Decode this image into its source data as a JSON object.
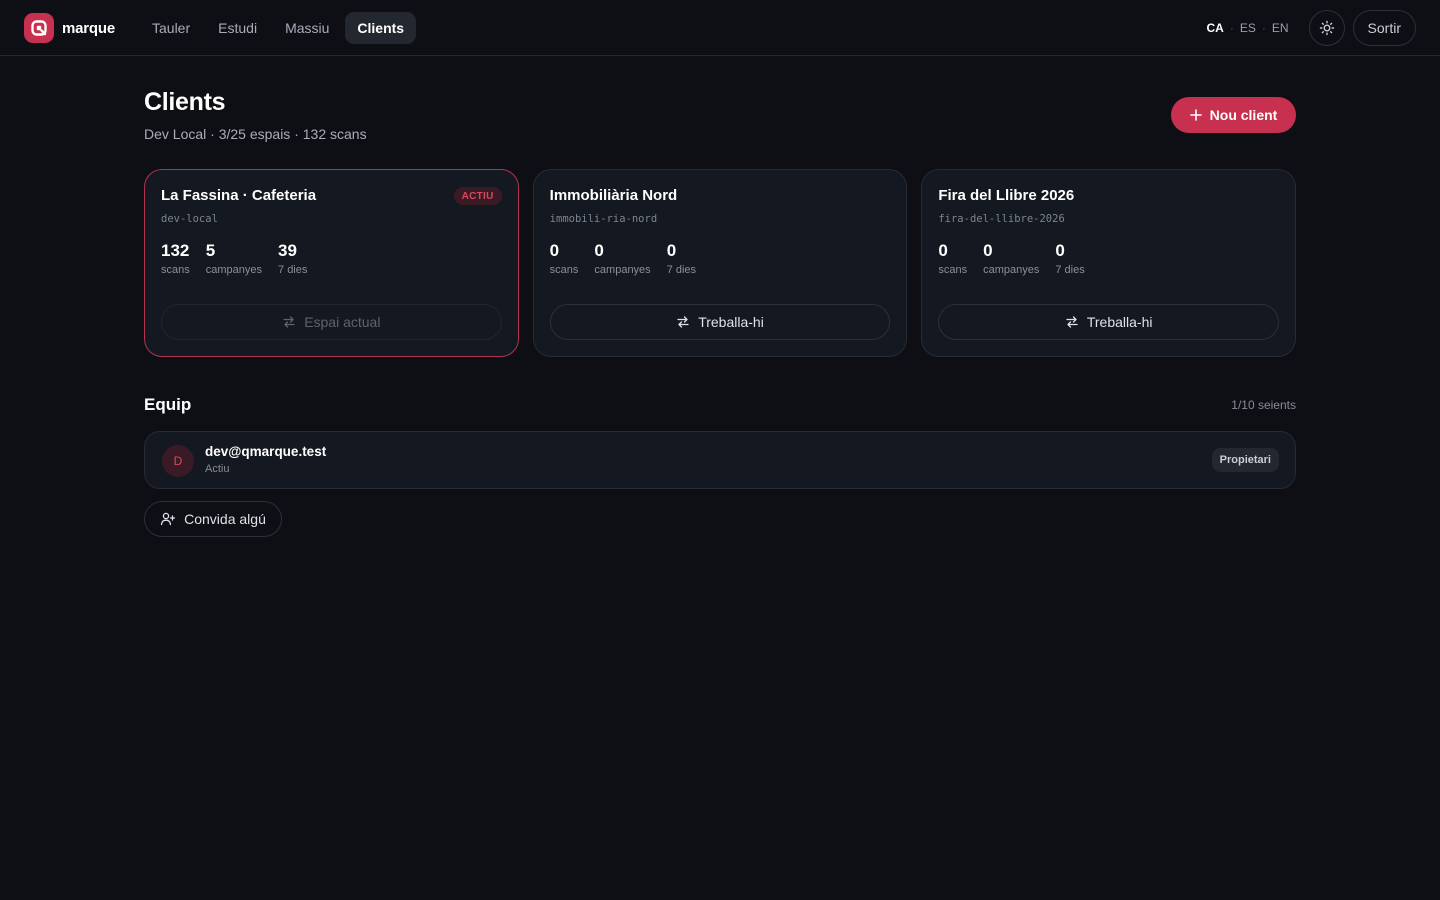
{
  "brand": {
    "name": "marque",
    "icon": "q-logo-icon",
    "accent": "#c8304f"
  },
  "nav": [
    {
      "label": "Tauler",
      "active": false
    },
    {
      "label": "Estudi",
      "active": false
    },
    {
      "label": "Massiu",
      "active": false
    },
    {
      "label": "Clients",
      "active": true
    }
  ],
  "languages": [
    {
      "code": "CA",
      "active": true
    },
    {
      "code": "ES",
      "active": false
    },
    {
      "code": "EN",
      "active": false
    }
  ],
  "theme_toggle": {
    "icon": "sun-icon"
  },
  "logout_label": "Sortir",
  "header": {
    "title": "Clients",
    "subtitle": "Dev Local · 3/25 espais · 132 scans",
    "new_client_label": "Nou client",
    "new_client_icon": "plus-icon"
  },
  "clients": [
    {
      "name": "La Fassina · Cafeteria",
      "slug": "dev-local",
      "badge": "ACTIU",
      "current": true,
      "stats": [
        {
          "value": "132",
          "label": "scans"
        },
        {
          "value": "5",
          "label": "campanyes"
        },
        {
          "value": "39",
          "label": "7 dies"
        }
      ],
      "action_label": "Espai actual",
      "action_icon": "switch-arrows-icon"
    },
    {
      "name": "Immobiliària Nord",
      "slug": "immobili-ria-nord",
      "badge": "",
      "current": false,
      "stats": [
        {
          "value": "0",
          "label": "scans"
        },
        {
          "value": "0",
          "label": "campanyes"
        },
        {
          "value": "0",
          "label": "7 dies"
        }
      ],
      "action_label": "Treballa-hi",
      "action_icon": "switch-arrows-icon"
    },
    {
      "name": "Fira del Llibre 2026",
      "slug": "fira-del-llibre-2026",
      "badge": "",
      "current": false,
      "stats": [
        {
          "value": "0",
          "label": "scans"
        },
        {
          "value": "0",
          "label": "campanyes"
        },
        {
          "value": "0",
          "label": "7 dies"
        }
      ],
      "action_label": "Treballa-hi",
      "action_icon": "switch-arrows-icon"
    }
  ],
  "team": {
    "title": "Equip",
    "seats": "1/10 seients",
    "members": [
      {
        "initial": "D",
        "email": "dev@qmarque.test",
        "status": "Actiu",
        "role": "Propietari"
      }
    ],
    "invite_label": "Convida algú",
    "invite_icon": "user-plus-icon"
  }
}
